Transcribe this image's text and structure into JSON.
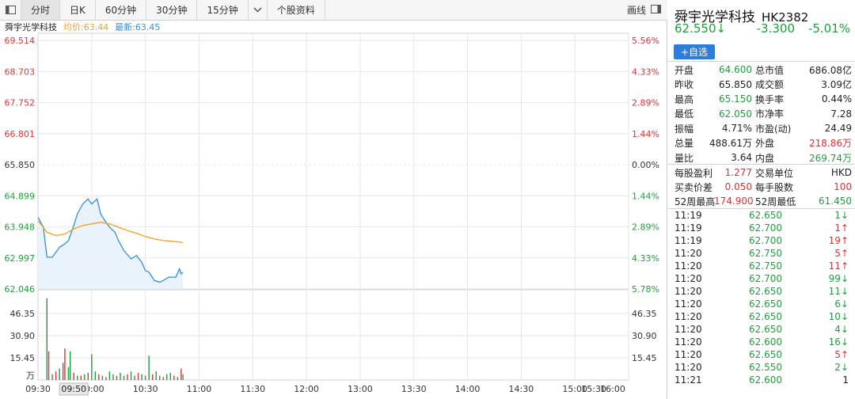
{
  "toolbar": {
    "tabs": [
      "分时",
      "日K",
      "60分钟",
      "30分钟",
      "15分钟",
      "个股资料"
    ],
    "active_tab": 0,
    "draw_label": "画线"
  },
  "chart_header": {
    "name": "舜宇光学科技",
    "avg_label": "均价:63.44",
    "last_label": "最新:63.45"
  },
  "chart_data": {
    "type": "line",
    "prev_close": 65.85,
    "ylim": [
      62.046,
      69.514
    ],
    "price_ticks": [
      "69.514",
      "68.703",
      "67.752",
      "66.801",
      "65.850",
      "64.899",
      "63.948",
      "62.997",
      "62.046"
    ],
    "pct_ticks": [
      "5.56%",
      "4.33%",
      "2.89%",
      "1.44%",
      "0.00%",
      "1.44%",
      "2.89%",
      "4.33%",
      "5.78%"
    ],
    "volume_ticks": [
      "46.35",
      "30.90",
      "15.45",
      "万"
    ],
    "volume_ylim": [
      0,
      61.8
    ],
    "x_ticks": [
      "09:30",
      "09:50",
      "10:00",
      "10:30",
      "11:00",
      "11:30",
      "12:00",
      "13:00",
      "13:30",
      "14:00",
      "14:30",
      "15:00",
      "15:30",
      "16:00"
    ],
    "x_cursor_label": "09:50",
    "series": [
      {
        "name": "最新",
        "x": [
          0,
          3,
          5,
          8,
          12,
          15,
          17,
          20,
          22,
          25,
          28,
          30,
          33,
          35,
          38,
          40,
          43,
          45,
          48,
          52,
          55,
          58,
          60,
          62,
          65,
          68,
          70,
          73,
          75,
          77,
          79,
          80,
          81
        ],
        "values": [
          64.2,
          63.9,
          63.0,
          63.0,
          63.3,
          63.4,
          63.5,
          63.95,
          64.3,
          64.6,
          64.75,
          64.6,
          64.75,
          64.3,
          64.05,
          63.9,
          63.75,
          63.5,
          63.2,
          62.95,
          63.05,
          62.85,
          62.6,
          62.55,
          62.3,
          62.25,
          62.3,
          62.4,
          62.4,
          62.4,
          62.65,
          62.5,
          62.55
        ]
      },
      {
        "name": "均价",
        "x": [
          0,
          5,
          10,
          15,
          20,
          25,
          30,
          35,
          40,
          45,
          50,
          55,
          60,
          65,
          70,
          75,
          81
        ],
        "values": [
          64.1,
          63.75,
          63.65,
          63.7,
          63.85,
          63.95,
          64.0,
          64.05,
          64.0,
          63.9,
          63.8,
          63.72,
          63.62,
          63.55,
          63.5,
          63.48,
          63.44
        ]
      }
    ],
    "volume": [
      {
        "x": 5,
        "v": 57,
        "c": "green"
      },
      {
        "x": 6,
        "v": 20,
        "c": "red"
      },
      {
        "x": 8,
        "v": 4,
        "c": "green"
      },
      {
        "x": 10,
        "v": 6,
        "c": "red"
      },
      {
        "x": 12,
        "v": 8,
        "c": "green"
      },
      {
        "x": 14,
        "v": 12,
        "c": "red"
      },
      {
        "x": 15,
        "v": 22,
        "c": "red"
      },
      {
        "x": 17,
        "v": 9,
        "c": "green"
      },
      {
        "x": 18,
        "v": 20,
        "c": "green"
      },
      {
        "x": 20,
        "v": 5,
        "c": "red"
      },
      {
        "x": 22,
        "v": 3,
        "c": "green"
      },
      {
        "x": 24,
        "v": 3,
        "c": "red"
      },
      {
        "x": 26,
        "v": 4,
        "c": "green"
      },
      {
        "x": 28,
        "v": 5,
        "c": "red"
      },
      {
        "x": 30,
        "v": 18,
        "c": "green"
      },
      {
        "x": 32,
        "v": 6,
        "c": "green"
      },
      {
        "x": 34,
        "v": 4,
        "c": "red"
      },
      {
        "x": 36,
        "v": 3,
        "c": "green"
      },
      {
        "x": 38,
        "v": 2,
        "c": "red"
      },
      {
        "x": 40,
        "v": 6,
        "c": "green"
      },
      {
        "x": 42,
        "v": 4,
        "c": "green"
      },
      {
        "x": 44,
        "v": 3,
        "c": "red"
      },
      {
        "x": 46,
        "v": 5,
        "c": "green"
      },
      {
        "x": 48,
        "v": 3,
        "c": "green"
      },
      {
        "x": 50,
        "v": 4,
        "c": "red"
      },
      {
        "x": 52,
        "v": 6,
        "c": "green"
      },
      {
        "x": 54,
        "v": 3,
        "c": "green"
      },
      {
        "x": 56,
        "v": 5,
        "c": "red"
      },
      {
        "x": 58,
        "v": 4,
        "c": "green"
      },
      {
        "x": 60,
        "v": 3,
        "c": "green"
      },
      {
        "x": 62,
        "v": 17,
        "c": "green"
      },
      {
        "x": 64,
        "v": 4,
        "c": "red"
      },
      {
        "x": 66,
        "v": 6,
        "c": "green"
      },
      {
        "x": 68,
        "v": 3,
        "c": "green"
      },
      {
        "x": 70,
        "v": 2,
        "c": "red"
      },
      {
        "x": 72,
        "v": 4,
        "c": "green"
      },
      {
        "x": 74,
        "v": 5,
        "c": "green"
      },
      {
        "x": 76,
        "v": 3,
        "c": "red"
      },
      {
        "x": 78,
        "v": 2,
        "c": "green"
      },
      {
        "x": 80,
        "v": 8,
        "c": "red"
      },
      {
        "x": 81,
        "v": 4,
        "c": "green"
      }
    ],
    "session_minutes": 330,
    "colors": {
      "up": "#e03232",
      "down": "#1e9f3a",
      "price_line": "#2f8fe0",
      "avg_line": "#f0a020",
      "grid": "#e6e6e6"
    }
  },
  "quote": {
    "name": "舜宇光学科技",
    "code": "HK2382",
    "last": "62.550↓",
    "change": "-3.300",
    "change_pct": "-5.01%",
    "add_button": "+自选",
    "stats": [
      {
        "k1": "开盘",
        "v1": "64.600",
        "c1": "green",
        "k2": "总市值",
        "v2": "686.08亿",
        "c2": "dark"
      },
      {
        "k1": "昨收",
        "v1": "65.850",
        "c1": "dark",
        "k2": "成交额",
        "v2": "3.09亿",
        "c2": "dark"
      },
      {
        "k1": "最高",
        "v1": "65.150",
        "c1": "green",
        "k2": "换手率",
        "v2": "0.44%",
        "c2": "dark"
      },
      {
        "k1": "最低",
        "v1": "62.050",
        "c1": "green",
        "k2": "市净率",
        "v2": "7.28",
        "c2": "dark"
      },
      {
        "k1": "振幅",
        "v1": "4.71%",
        "c1": "dark",
        "k2": "市盈(动)",
        "v2": "24.49",
        "c2": "dark"
      },
      {
        "k1": "总量",
        "v1": "488.61万",
        "c1": "dark",
        "k2": "外盘",
        "v2": "218.86万",
        "c2": "red"
      },
      {
        "k1": "量比",
        "v1": "3.64",
        "c1": "dark",
        "k2": "内盘",
        "v2": "269.74万",
        "c2": "green"
      }
    ],
    "stats2": [
      {
        "k1": "每股盈利",
        "v1": "1.277",
        "c1": "red",
        "k2": "交易单位",
        "v2": "HKD",
        "c2": "dark"
      },
      {
        "k1": "买卖价差",
        "v1": "0.050",
        "c1": "red",
        "k2": "每手股数",
        "v2": "100",
        "c2": "red"
      },
      {
        "k1": "52周最高",
        "v1": "174.900",
        "c1": "red",
        "k2": "52周最低",
        "v2": "61.450",
        "c2": "green"
      }
    ],
    "ticks": [
      {
        "t": "11:19",
        "p": "62.650",
        "v": "1↓",
        "c": "green"
      },
      {
        "t": "11:19",
        "p": "62.700",
        "v": "1↑",
        "c": "red"
      },
      {
        "t": "11:19",
        "p": "62.700",
        "v": "19↑",
        "c": "red"
      },
      {
        "t": "11:20",
        "p": "62.750",
        "v": "5↑",
        "c": "red"
      },
      {
        "t": "11:20",
        "p": "62.750",
        "v": "11↑",
        "c": "red"
      },
      {
        "t": "11:20",
        "p": "62.700",
        "v": "99↓",
        "c": "green"
      },
      {
        "t": "11:20",
        "p": "62.650",
        "v": "11↓",
        "c": "green"
      },
      {
        "t": "11:20",
        "p": "62.650",
        "v": "6↓",
        "c": "green"
      },
      {
        "t": "11:20",
        "p": "62.650",
        "v": "10↓",
        "c": "green"
      },
      {
        "t": "11:20",
        "p": "62.650",
        "v": "4↓",
        "c": "green"
      },
      {
        "t": "11:20",
        "p": "62.600",
        "v": "16↓",
        "c": "green"
      },
      {
        "t": "11:20",
        "p": "62.650",
        "v": "5↑",
        "c": "red"
      },
      {
        "t": "11:20",
        "p": "62.550",
        "v": "2↓",
        "c": "green"
      },
      {
        "t": "11:21",
        "p": "62.600",
        "v": "1",
        "c": "dark"
      }
    ]
  }
}
